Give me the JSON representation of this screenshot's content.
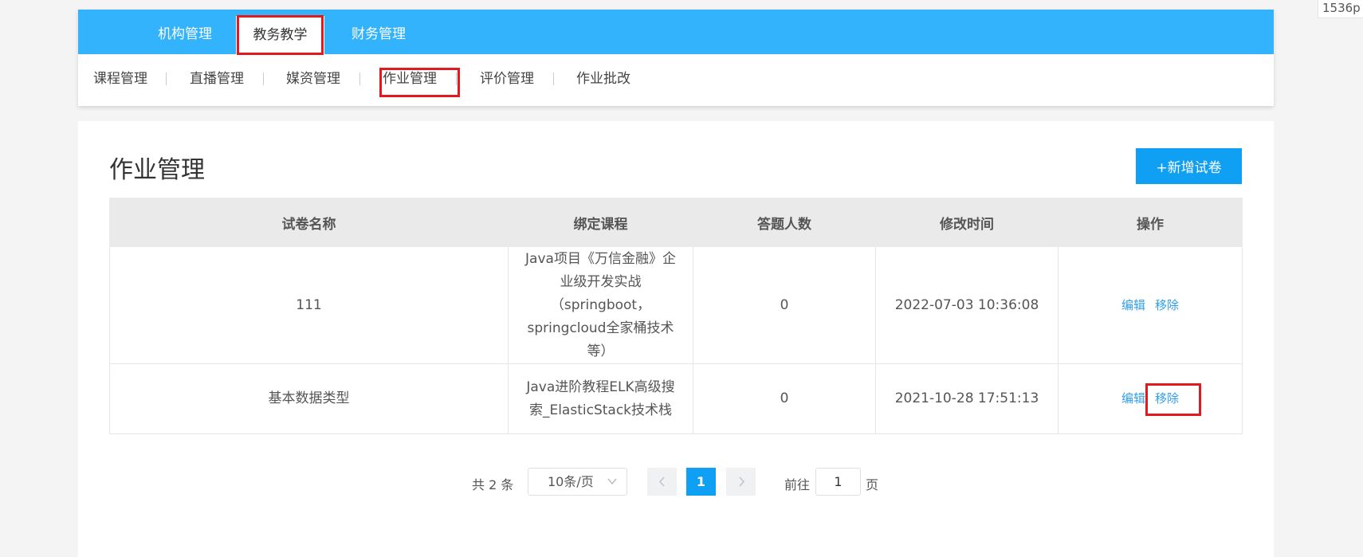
{
  "corner_label": "1536p",
  "top_nav": {
    "tabs": [
      {
        "label": "机构管理"
      },
      {
        "label": "教务教学"
      },
      {
        "label": "财务管理"
      }
    ],
    "active_index": 1
  },
  "sub_nav": {
    "tabs": [
      {
        "label": "课程管理"
      },
      {
        "label": "直播管理"
      },
      {
        "label": "媒资管理"
      },
      {
        "label": "作业管理"
      },
      {
        "label": "评价管理"
      },
      {
        "label": "作业批改"
      }
    ],
    "active_index": 3
  },
  "main": {
    "title": "作业管理",
    "add_button_label": "+新增试卷"
  },
  "table": {
    "columns": [
      "试卷名称",
      "绑定课程",
      "答题人数",
      "修改时间",
      "操作"
    ],
    "rows": [
      {
        "name": "111",
        "course": "Java项目《万信金融》企业级开发实战（springboot，springcloud全家桶技术等）",
        "count": "0",
        "modified": "2022-07-03 10:36:08",
        "edit_label": "编辑",
        "remove_label": "移除"
      },
      {
        "name": "基本数据类型",
        "course": "Java进阶教程ELK高级搜索_ElasticStack技术栈",
        "count": "0",
        "modified": "2021-10-28 17:51:13",
        "edit_label": "编辑",
        "remove_label": "移除"
      }
    ]
  },
  "pagination": {
    "total": "共 2 条",
    "page_size": "10条/页",
    "prev_icon": "chevron-left-icon",
    "next_icon": "chevron-right-icon",
    "current_page": "1",
    "goto_label": "前往",
    "goto_value": "1",
    "goto_suffix": "页"
  },
  "colors": {
    "nav_blue": "#32b3fb",
    "accent_blue": "#0fa0f4",
    "link_blue": "#2e9ff0",
    "highlight_red": "#e11a1f"
  }
}
